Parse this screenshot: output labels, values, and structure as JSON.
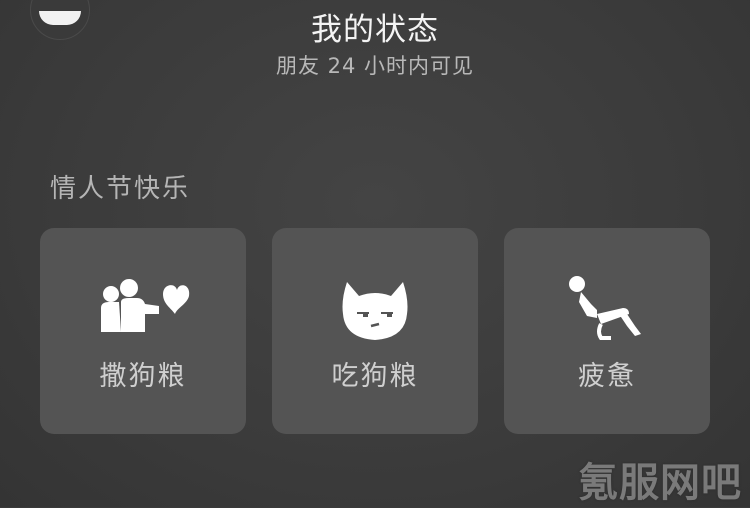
{
  "header": {
    "title": "我的状态",
    "subtitle": "朋友 24 小时内可见"
  },
  "section": {
    "title": "情人节快乐"
  },
  "cards": [
    {
      "label": "撒狗粮",
      "icon": "couple-heart-icon"
    },
    {
      "label": "吃狗粮",
      "icon": "cat-face-icon"
    },
    {
      "label": "疲惫",
      "icon": "tired-person-chair-icon"
    }
  ],
  "watermark": {
    "text": "氪服网吧"
  },
  "colors": {
    "background": "#3a3a3a",
    "card": "#545454",
    "icon": "#ffffff",
    "label": "#cfcfcf"
  }
}
